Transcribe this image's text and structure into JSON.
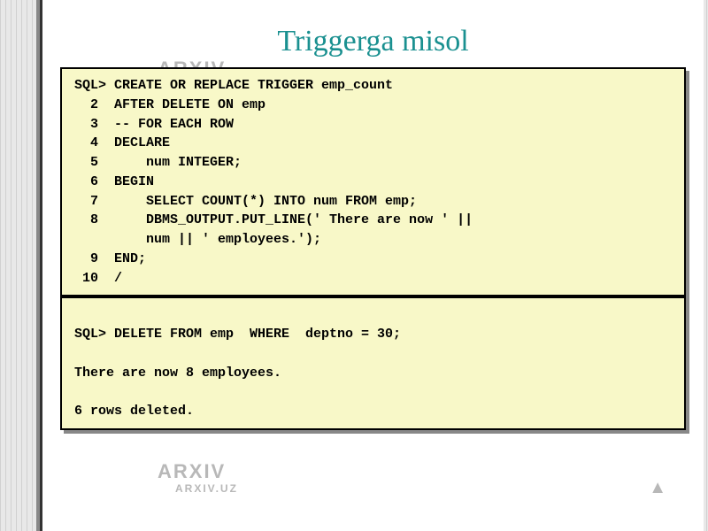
{
  "title": "Triggerga misol",
  "watermark_main": "ARXIV",
  "watermark_sub": "ARXIV.UZ",
  "code_block_1": {
    "lines": [
      "SQL> CREATE OR REPLACE TRIGGER emp_count",
      "  2  AFTER DELETE ON emp",
      "  3  -- FOR EACH ROW",
      "  4  DECLARE",
      "  5      num INTEGER;",
      "  6  BEGIN",
      "  7      SELECT COUNT(*) INTO num FROM emp;",
      "  8      DBMS_OUTPUT.PUT_LINE(' There are now ' ||",
      "         num || ' employees.');",
      "  9  END;",
      " 10  /"
    ]
  },
  "code_block_2": {
    "lines": [
      "",
      "SQL> DELETE FROM emp  WHERE  deptno = 30;",
      "",
      "There are now 8 employees.",
      "",
      "6 rows deleted."
    ]
  }
}
